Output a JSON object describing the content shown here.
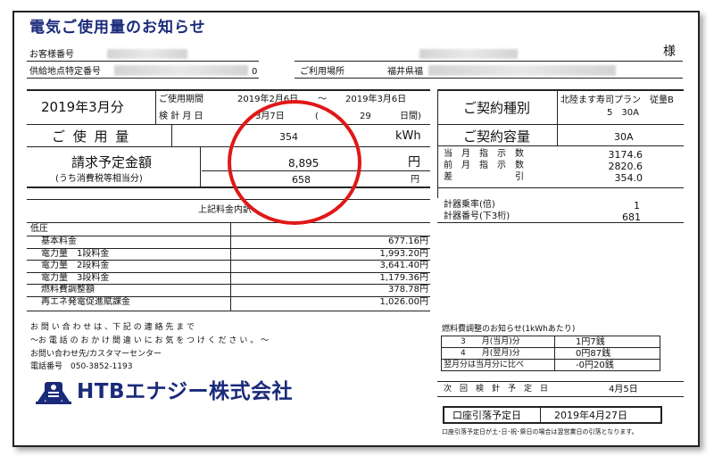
{
  "title": "電気ご使用量のお知らせ",
  "header": {
    "customer_number_label": "お客様番号",
    "supply_point_label": "供給地点特定番号",
    "supply_point_suffix": "0",
    "usage_place_label": "ご利用場所",
    "usage_place_value": "福井県福",
    "sama": "様"
  },
  "period": {
    "month": "2019年3月分",
    "usage_period_label": "ご使用期間",
    "start_date": "2019年2月6日",
    "tilde": "～",
    "end_date": "2019年3月6日",
    "meter_date_label": "検 針 月 日",
    "meter_date": "3月7日",
    "days_open": "(",
    "days": "29",
    "days_close": "日間)"
  },
  "usage": {
    "label": "ご 使 用 量",
    "value": "354",
    "unit": "kWh"
  },
  "billing": {
    "label": "請求予定金額",
    "tax_label": "(うち消費税等相当分)",
    "amount": "8,895",
    "tax": "658",
    "unit": "円",
    "unit2": "円"
  },
  "contract": {
    "type_label": "ご契約種別",
    "type_value_line1": "北陸ます寿司プラン　従量B",
    "type_value_line2": "5　30A",
    "capacity_label": "ご契約容量",
    "capacity_value": "30A"
  },
  "meter": {
    "rows": [
      {
        "label": "当　月　指　示　数",
        "value": "3174.6"
      },
      {
        "label": "前　月　指　示　数",
        "value": "2820.6"
      },
      {
        "label": "差　　　　　　　引",
        "value": "354.0"
      }
    ],
    "multiplier_label": "計器乗率(倍)",
    "multiplier_value": "1",
    "meter_no_label": "計器番号(下3桁)",
    "meter_no_value": "681"
  },
  "breakdown": {
    "heading": "上記料金内訳",
    "category": "低圧",
    "rows": [
      {
        "label": "基本料金",
        "value": "677.16円"
      },
      {
        "label": "電力量　1段料金",
        "value": "1,993.20円"
      },
      {
        "label": "電力量　2段料金",
        "value": "3,641.40円"
      },
      {
        "label": "電力量　3段料金",
        "value": "1,179.36円"
      },
      {
        "label": "燃料費調整額",
        "value": "378.78円"
      },
      {
        "label": "再エネ発電促進賦課金",
        "value": "1,026.00円"
      }
    ]
  },
  "contact": {
    "line1": "お 問 い 合 わ せ は 、下 記 の 連 絡 先 ま で",
    "line2": "～お 電 話 の お か け 間 違 い に お 気 を つ け く だ さ い 。 ～",
    "line3": "お問い合わせ先/カスタマーセンター",
    "line4": "電話番号　050-3852-1193",
    "company": "HTBエナジー株式会社"
  },
  "fuel_notice": {
    "title": "燃料費調整のお知らせ(1kWhあたり)",
    "rows": [
      {
        "label": "3　　月(当月)分",
        "value": "1円7銭"
      },
      {
        "label": "4　　月(翌月)分",
        "value": "0円87銭"
      },
      {
        "label": "翌月分は当月分に比べ",
        "value": "-0円20銭"
      }
    ]
  },
  "next_meter": {
    "label": "次　回　検　針　予　定　日",
    "value": "4月5日"
  },
  "debit": {
    "label": "口座引落予定日",
    "value": "2019年4月27日",
    "note": "口座引落予定日が土･日･祝･祭日の場合は翌営業日の引落となります。"
  },
  "colors": {
    "title": "#1a2a7a",
    "circle": "#e01818"
  }
}
